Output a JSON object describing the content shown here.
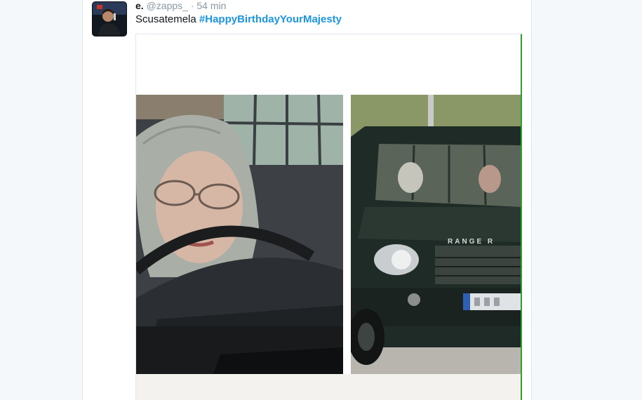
{
  "tweet": {
    "author_name": "e.",
    "handle": "@zapps_",
    "separator": "·",
    "time": "54 min",
    "text": "Scusatemela",
    "hashtag": "#HappyBirthdayYourMajesty"
  },
  "media": {
    "grille_text": "RANGE R"
  },
  "colors": {
    "hashtag": "#1b95e0",
    "muted": "#8899a6",
    "background": "#f5f8fa"
  },
  "icons": [
    "avatar-image"
  ]
}
